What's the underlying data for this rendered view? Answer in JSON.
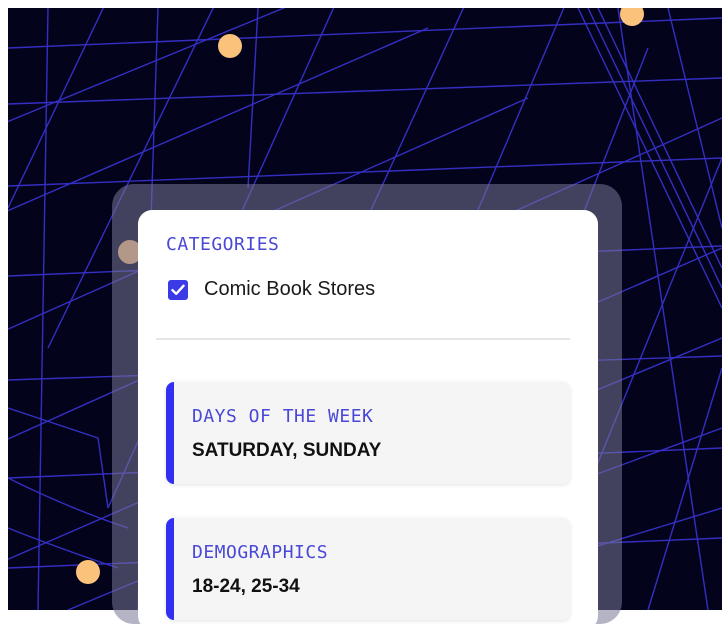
{
  "map": {
    "background": "#03031c",
    "street_color": "#3a34d4",
    "marker_color": "#fbc27c"
  },
  "filters": {
    "categories": {
      "title": "CATEGORIES",
      "items": [
        {
          "label": "Comic Book Stores",
          "checked": true
        }
      ]
    },
    "days_of_week": {
      "title": "DAYS OF THE WEEK",
      "value": "SATURDAY, SUNDAY"
    },
    "demographics": {
      "title": "DEMOGRAPHICS",
      "value": "18-24, 25-34"
    }
  }
}
